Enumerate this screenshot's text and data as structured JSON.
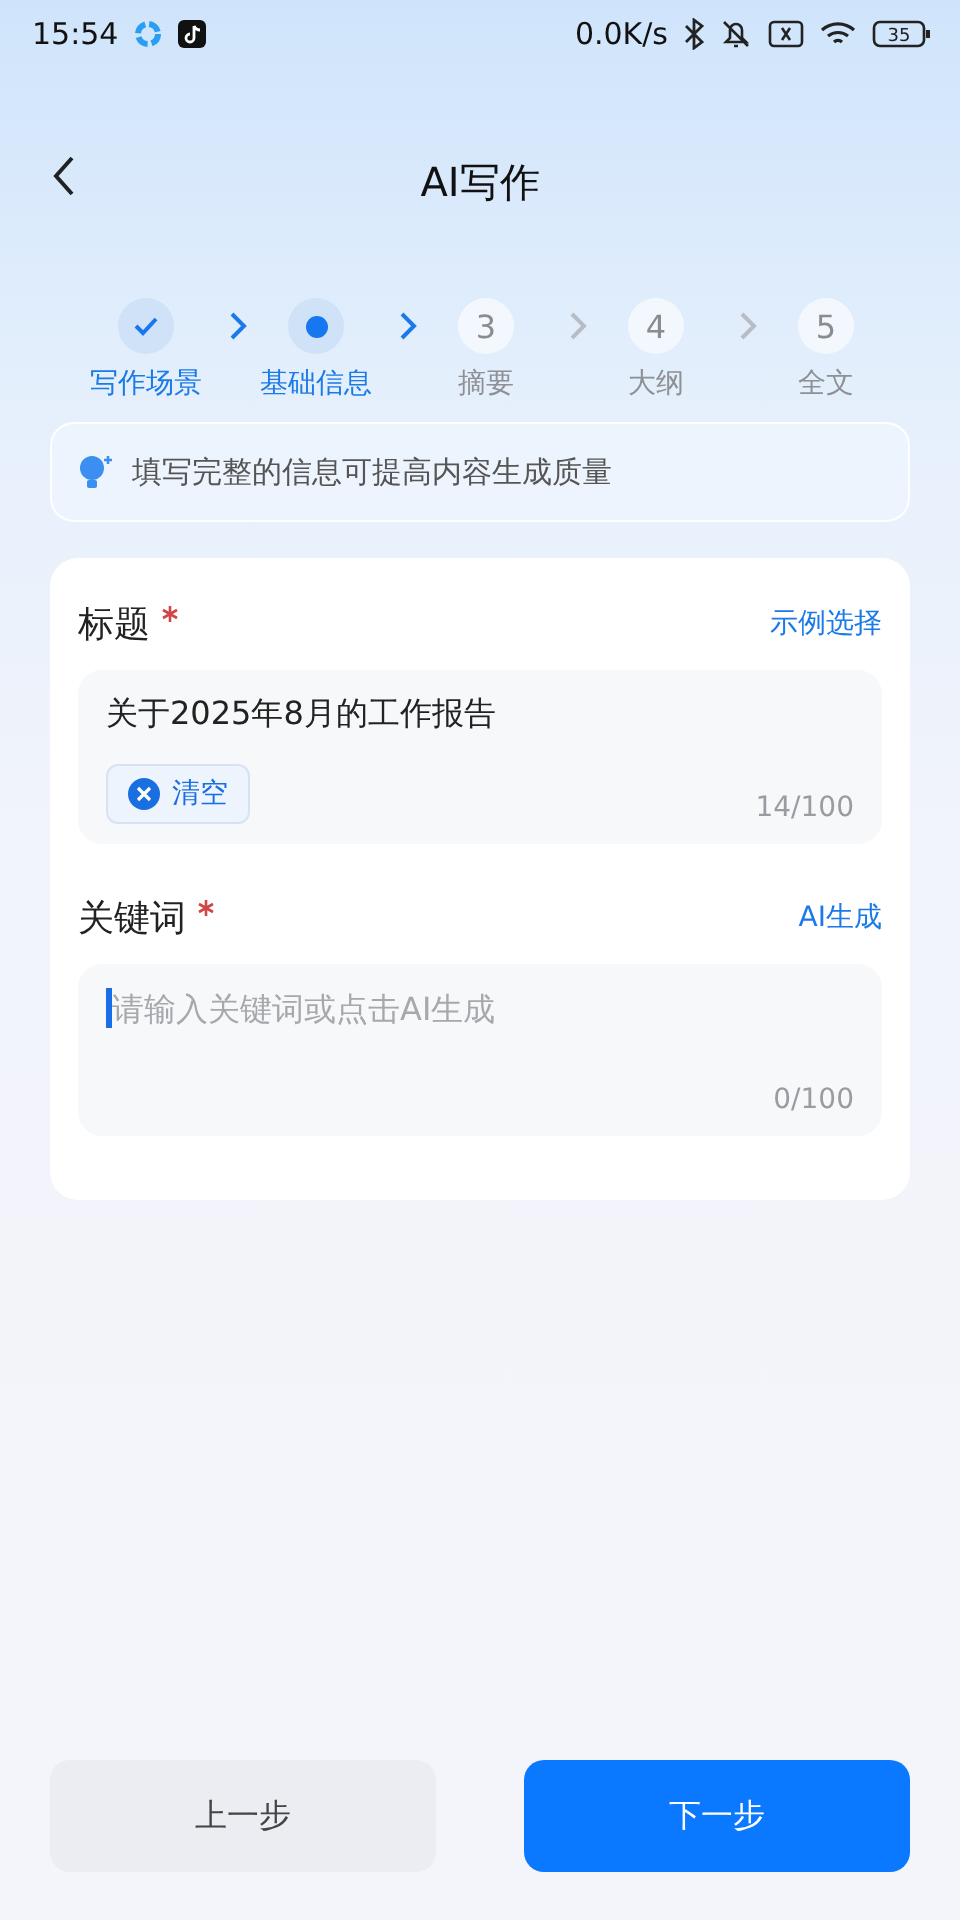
{
  "status_bar": {
    "time": "15:54",
    "speed": "0.0K/s",
    "battery": "35"
  },
  "header": {
    "title": "AI写作"
  },
  "steps": [
    {
      "label": "写作场景",
      "kind": "done"
    },
    {
      "label": "基础信息",
      "kind": "current"
    },
    {
      "number": "3",
      "label": "摘要",
      "kind": "pending"
    },
    {
      "number": "4",
      "label": "大纲",
      "kind": "pending"
    },
    {
      "number": "5",
      "label": "全文",
      "kind": "pending"
    }
  ],
  "tip": "填写完整的信息可提高内容生成质量",
  "fields": [
    {
      "label": "标题",
      "required": true,
      "action": "示例选择",
      "value": "关于2025年8月的工作报告",
      "clear_label": "清空",
      "count": "14/100",
      "focused": false
    },
    {
      "label": "关键词",
      "required": true,
      "action": "AI生成",
      "placeholder": "请输入关键词或点击AI生成",
      "count": "0/100",
      "focused": true
    }
  ],
  "buttons": {
    "prev": "上一步",
    "next": "下一步"
  }
}
